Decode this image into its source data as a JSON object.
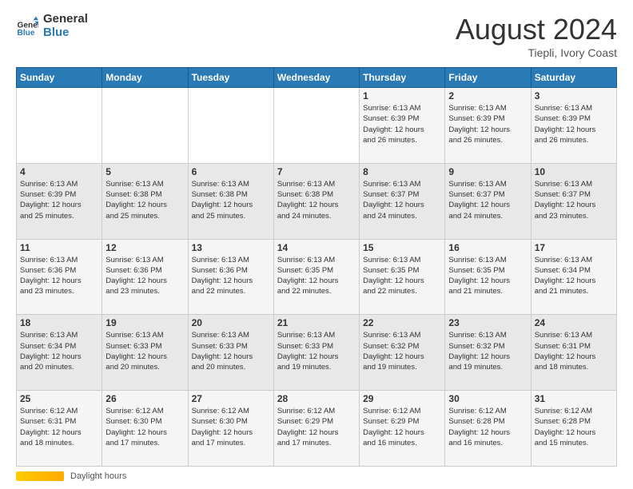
{
  "header": {
    "logo_line1": "General",
    "logo_line2": "Blue",
    "month_title": "August 2024",
    "location": "Tiepli, Ivory Coast"
  },
  "days_of_week": [
    "Sunday",
    "Monday",
    "Tuesday",
    "Wednesday",
    "Thursday",
    "Friday",
    "Saturday"
  ],
  "weeks": [
    [
      {
        "day": "",
        "info": ""
      },
      {
        "day": "",
        "info": ""
      },
      {
        "day": "",
        "info": ""
      },
      {
        "day": "",
        "info": ""
      },
      {
        "day": "1",
        "info": "Sunrise: 6:13 AM\nSunset: 6:39 PM\nDaylight: 12 hours\nand 26 minutes."
      },
      {
        "day": "2",
        "info": "Sunrise: 6:13 AM\nSunset: 6:39 PM\nDaylight: 12 hours\nand 26 minutes."
      },
      {
        "day": "3",
        "info": "Sunrise: 6:13 AM\nSunset: 6:39 PM\nDaylight: 12 hours\nand 26 minutes."
      }
    ],
    [
      {
        "day": "4",
        "info": "Sunrise: 6:13 AM\nSunset: 6:39 PM\nDaylight: 12 hours\nand 25 minutes."
      },
      {
        "day": "5",
        "info": "Sunrise: 6:13 AM\nSunset: 6:38 PM\nDaylight: 12 hours\nand 25 minutes."
      },
      {
        "day": "6",
        "info": "Sunrise: 6:13 AM\nSunset: 6:38 PM\nDaylight: 12 hours\nand 25 minutes."
      },
      {
        "day": "7",
        "info": "Sunrise: 6:13 AM\nSunset: 6:38 PM\nDaylight: 12 hours\nand 24 minutes."
      },
      {
        "day": "8",
        "info": "Sunrise: 6:13 AM\nSunset: 6:37 PM\nDaylight: 12 hours\nand 24 minutes."
      },
      {
        "day": "9",
        "info": "Sunrise: 6:13 AM\nSunset: 6:37 PM\nDaylight: 12 hours\nand 24 minutes."
      },
      {
        "day": "10",
        "info": "Sunrise: 6:13 AM\nSunset: 6:37 PM\nDaylight: 12 hours\nand 23 minutes."
      }
    ],
    [
      {
        "day": "11",
        "info": "Sunrise: 6:13 AM\nSunset: 6:36 PM\nDaylight: 12 hours\nand 23 minutes."
      },
      {
        "day": "12",
        "info": "Sunrise: 6:13 AM\nSunset: 6:36 PM\nDaylight: 12 hours\nand 23 minutes."
      },
      {
        "day": "13",
        "info": "Sunrise: 6:13 AM\nSunset: 6:36 PM\nDaylight: 12 hours\nand 22 minutes."
      },
      {
        "day": "14",
        "info": "Sunrise: 6:13 AM\nSunset: 6:35 PM\nDaylight: 12 hours\nand 22 minutes."
      },
      {
        "day": "15",
        "info": "Sunrise: 6:13 AM\nSunset: 6:35 PM\nDaylight: 12 hours\nand 22 minutes."
      },
      {
        "day": "16",
        "info": "Sunrise: 6:13 AM\nSunset: 6:35 PM\nDaylight: 12 hours\nand 21 minutes."
      },
      {
        "day": "17",
        "info": "Sunrise: 6:13 AM\nSunset: 6:34 PM\nDaylight: 12 hours\nand 21 minutes."
      }
    ],
    [
      {
        "day": "18",
        "info": "Sunrise: 6:13 AM\nSunset: 6:34 PM\nDaylight: 12 hours\nand 20 minutes."
      },
      {
        "day": "19",
        "info": "Sunrise: 6:13 AM\nSunset: 6:33 PM\nDaylight: 12 hours\nand 20 minutes."
      },
      {
        "day": "20",
        "info": "Sunrise: 6:13 AM\nSunset: 6:33 PM\nDaylight: 12 hours\nand 20 minutes."
      },
      {
        "day": "21",
        "info": "Sunrise: 6:13 AM\nSunset: 6:33 PM\nDaylight: 12 hours\nand 19 minutes."
      },
      {
        "day": "22",
        "info": "Sunrise: 6:13 AM\nSunset: 6:32 PM\nDaylight: 12 hours\nand 19 minutes."
      },
      {
        "day": "23",
        "info": "Sunrise: 6:13 AM\nSunset: 6:32 PM\nDaylight: 12 hours\nand 19 minutes."
      },
      {
        "day": "24",
        "info": "Sunrise: 6:13 AM\nSunset: 6:31 PM\nDaylight: 12 hours\nand 18 minutes."
      }
    ],
    [
      {
        "day": "25",
        "info": "Sunrise: 6:12 AM\nSunset: 6:31 PM\nDaylight: 12 hours\nand 18 minutes."
      },
      {
        "day": "26",
        "info": "Sunrise: 6:12 AM\nSunset: 6:30 PM\nDaylight: 12 hours\nand 17 minutes."
      },
      {
        "day": "27",
        "info": "Sunrise: 6:12 AM\nSunset: 6:30 PM\nDaylight: 12 hours\nand 17 minutes."
      },
      {
        "day": "28",
        "info": "Sunrise: 6:12 AM\nSunset: 6:29 PM\nDaylight: 12 hours\nand 17 minutes."
      },
      {
        "day": "29",
        "info": "Sunrise: 6:12 AM\nSunset: 6:29 PM\nDaylight: 12 hours\nand 16 minutes."
      },
      {
        "day": "30",
        "info": "Sunrise: 6:12 AM\nSunset: 6:28 PM\nDaylight: 12 hours\nand 16 minutes."
      },
      {
        "day": "31",
        "info": "Sunrise: 6:12 AM\nSunset: 6:28 PM\nDaylight: 12 hours\nand 15 minutes."
      }
    ]
  ],
  "footer": {
    "daylight_label": "Daylight hours"
  }
}
